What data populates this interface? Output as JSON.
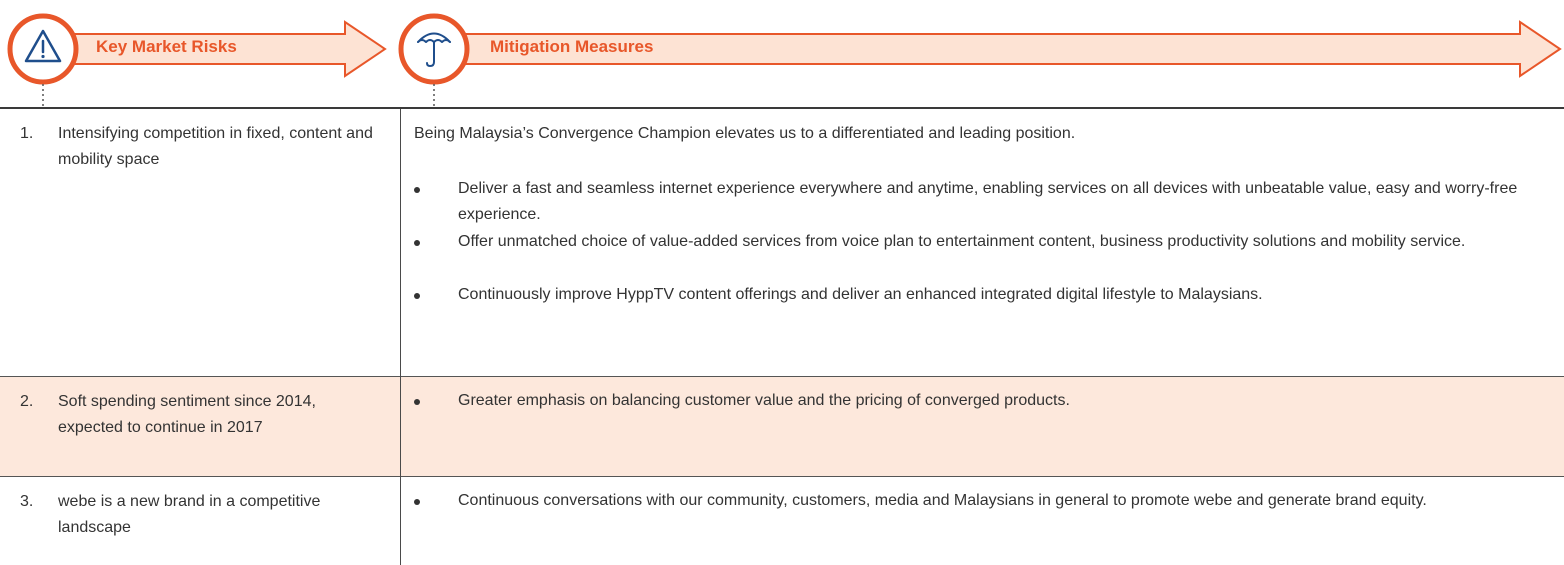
{
  "header": {
    "risks_label": "Key Market Risks",
    "mitigation_label": "Mitigation Measures",
    "risks_icon": "warning-icon",
    "mitigation_icon": "umbrella-icon",
    "accent_color": "#e8572a",
    "arrow_fill": "#fde3d4"
  },
  "rows": [
    {
      "number": "1.",
      "risk": "Intensifying competition in fixed, content and mobility space",
      "intro": "Being Malaysia’s Convergence Champion elevates us to a differentiated and leading position.",
      "bullets": [
        "Deliver a fast and seamless internet experience everywhere and anytime, enabling services on all devices with unbeatable value, easy and worry-free experience.",
        "Offer unmatched choice of value-added services from voice plan to entertainment content, business productivity solutions and mobility service.",
        "Continuously improve HyppTV content offerings and deliver an enhanced integrated digital lifestyle to Malaysians."
      ]
    },
    {
      "number": "2.",
      "risk": "Soft spending sentiment since 2014, expected to continue in 2017",
      "bullets": [
        "Greater emphasis on balancing customer value and the pricing of converged products."
      ]
    },
    {
      "number": "3.",
      "risk": "webe is a new brand in a competitive landscape",
      "bullets": [
        "Continuous conversations with our community, customers, media and Malaysians in general to promote webe and generate brand equity."
      ]
    }
  ]
}
